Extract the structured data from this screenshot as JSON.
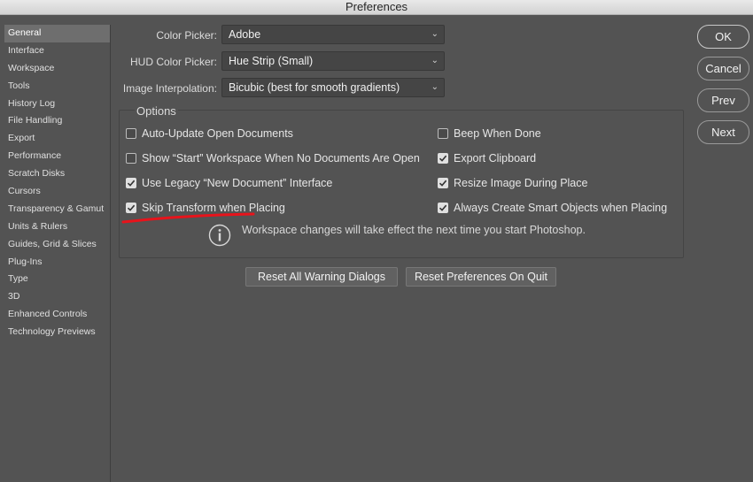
{
  "window": {
    "title": "Preferences"
  },
  "sidebar": {
    "items": [
      {
        "label": "General",
        "selected": true
      },
      {
        "label": "Interface"
      },
      {
        "label": "Workspace"
      },
      {
        "label": "Tools"
      },
      {
        "label": "History Log"
      },
      {
        "label": "File Handling"
      },
      {
        "label": "Export"
      },
      {
        "label": "Performance"
      },
      {
        "label": "Scratch Disks"
      },
      {
        "label": "Cursors"
      },
      {
        "label": "Transparency & Gamut"
      },
      {
        "label": "Units & Rulers"
      },
      {
        "label": "Guides, Grid & Slices"
      },
      {
        "label": "Plug-Ins"
      },
      {
        "label": "Type"
      },
      {
        "label": "3D"
      },
      {
        "label": "Enhanced Controls"
      },
      {
        "label": "Technology Previews"
      }
    ]
  },
  "general": {
    "color_picker": {
      "label": "Color Picker:",
      "value": "Adobe"
    },
    "hud_color_picker": {
      "label": "HUD Color Picker:",
      "value": "Hue Strip (Small)"
    },
    "image_interpolation": {
      "label": "Image Interpolation:",
      "value": "Bicubic (best for smooth gradients)"
    }
  },
  "options": {
    "title": "Options",
    "left": [
      {
        "label": "Auto-Update Open Documents",
        "checked": false
      },
      {
        "label": "Show “Start” Workspace When No Documents Are Open",
        "checked": false
      },
      {
        "label": "Use Legacy “New Document” Interface",
        "checked": true
      },
      {
        "label": "Skip Transform when Placing",
        "checked": true
      }
    ],
    "right": [
      {
        "label": "Beep When Done",
        "checked": false
      },
      {
        "label": "Export Clipboard",
        "checked": true
      },
      {
        "label": "Resize Image During Place",
        "checked": true
      },
      {
        "label": "Always Create Smart Objects when Placing",
        "checked": true
      }
    ],
    "info": "Workspace changes will take effect the next time you start Photoshop."
  },
  "actions": {
    "reset_warnings": "Reset All Warning Dialogs",
    "reset_prefs": "Reset Preferences On Quit"
  },
  "buttons": {
    "ok": "OK",
    "cancel": "Cancel",
    "prev": "Prev",
    "next": "Next"
  },
  "colors": {
    "background": "#535353",
    "annotation": "#e8131b"
  },
  "icons": {
    "info": "info-circle-icon",
    "chevron": "chevron-down-icon",
    "check": "checkmark-icon"
  }
}
